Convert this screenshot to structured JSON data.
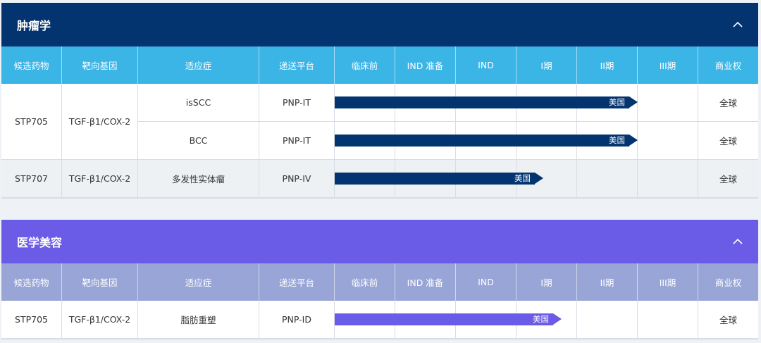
{
  "sections": [
    {
      "title": "肿瘤学",
      "accent": "#033470",
      "header_color": "#3bb4e6",
      "rows": [
        {
          "drug": "STP705",
          "target": "TGF-β1/COX-2",
          "indication": "isSCC",
          "platform": "PNP-IT",
          "progress_phase": "II期",
          "bar_label": "美国",
          "rights": "全球"
        },
        {
          "drug": "STP705",
          "target": "TGF-β1/COX-2",
          "indication": "BCC",
          "platform": "PNP-IT",
          "progress_phase": "II期",
          "bar_label": "美国",
          "rights": "全球"
        },
        {
          "drug": "STP707",
          "target": "TGF-β1/COX-2",
          "indication": "多发性实体瘤",
          "platform": "PNP-IV",
          "progress_phase": "I期",
          "bar_label": "美国",
          "rights": "全球"
        }
      ]
    },
    {
      "title": "医学美容",
      "accent": "#6b5ce7",
      "header_color": "#98a5d6",
      "rows": [
        {
          "drug": "STP705",
          "target": "TGF-β1/COX-2",
          "indication": "脂肪重塑",
          "platform": "PNP-ID",
          "progress_phase": "I期",
          "bar_label": "美国",
          "rights": "全球"
        }
      ]
    }
  ],
  "columns": [
    "候选药物",
    "靶向基因",
    "适应症",
    "递送平台",
    "临床前",
    "IND 准备",
    "IND",
    "I期",
    "II期",
    "III期",
    "商业权"
  ],
  "icons": {
    "collapse": "chevron-up-icon"
  }
}
